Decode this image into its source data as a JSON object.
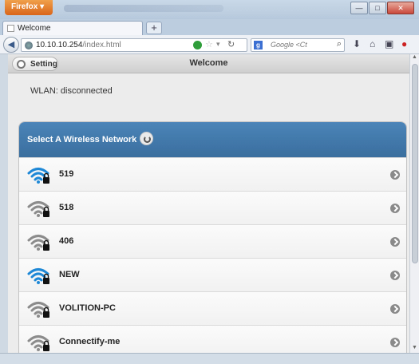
{
  "browser": {
    "menu_button": "Firefox",
    "tab_title": "Welcome",
    "new_tab": "+",
    "url_host": "10.10.10.254",
    "url_path": "/index.html",
    "search_placeholder": "Google <Ct"
  },
  "app": {
    "header_title": "Welcome",
    "setting_label": "Setting",
    "wlan_status": "WLAN: disconnected",
    "list_title": "Select A Wireless Network",
    "networks": [
      {
        "name": "519",
        "signal": "strong"
      },
      {
        "name": "518",
        "signal": "medium"
      },
      {
        "name": "406",
        "signal": "medium"
      },
      {
        "name": "NEW",
        "signal": "strong"
      },
      {
        "name": "VOLITION-PC",
        "signal": "medium"
      },
      {
        "name": "Connectify-me",
        "signal": "medium"
      }
    ]
  },
  "colors": {
    "list_header": "#3f76a8",
    "wifi_strong": "#1e88d6",
    "wifi_weak": "#8c8c8c"
  }
}
